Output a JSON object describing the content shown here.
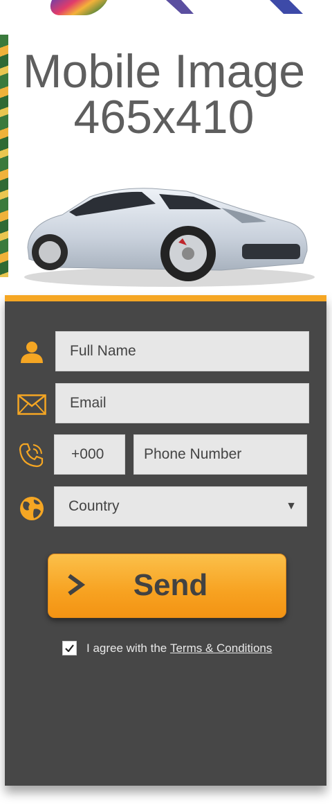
{
  "hero": {
    "line1": "Mobile Image",
    "line2": "465x410"
  },
  "form": {
    "accent_color": "#f5a623",
    "panel_color": "#474747",
    "full_name_placeholder": "Full Name",
    "email_placeholder": "Email",
    "phone_code_placeholder": "+000",
    "phone_placeholder": "Phone Number",
    "country_selected": "Country",
    "send_label": "Send",
    "agree_checked": true,
    "agree_text": "I agree with the ",
    "terms_link": "Terms & Conditions"
  },
  "icons": {
    "name": "user-icon",
    "email": "envelope-icon",
    "phone": "phone-icon",
    "country": "globe-icon",
    "send": "chevron-right-icon",
    "select": "chevron-down-icon"
  }
}
